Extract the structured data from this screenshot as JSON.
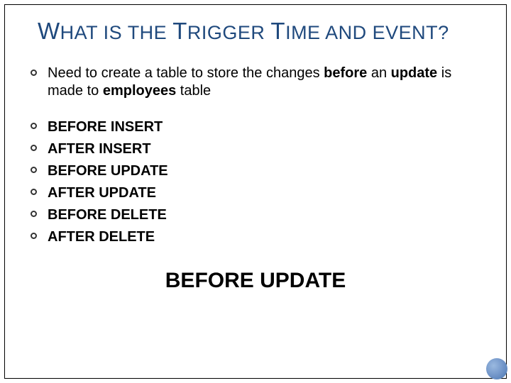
{
  "title_html": "<span class='cap'>W</span>HAT IS THE <span class='cap'>T</span>RIGGER <span class='cap'>T</span>IME AND EVENT?",
  "intro_html": "Need to create a table to store the changes <b>before</b> an <b>update</b> is made to <b>employees</b> table",
  "options": [
    "BEFORE INSERT",
    "AFTER INSERT",
    "BEFORE UPDATE",
    "AFTER UPDATE",
    "BEFORE DELETE",
    "AFTER DELETE"
  ],
  "answer": "BEFORE UPDATE"
}
